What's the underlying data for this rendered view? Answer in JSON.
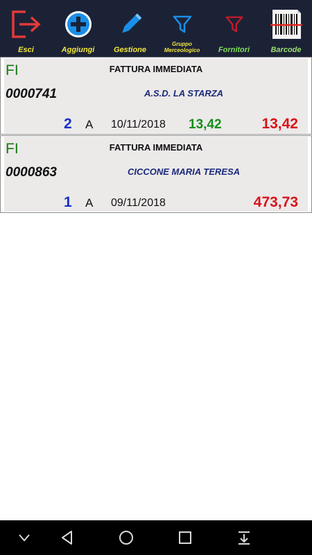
{
  "toolbar": {
    "buttons": [
      {
        "label": "Esci",
        "icon": "exit-icon"
      },
      {
        "label": "Aggiungi",
        "icon": "add-icon"
      },
      {
        "label": "Gestione",
        "icon": "pencil-icon"
      },
      {
        "label": "Gruppo Merceologico",
        "icon": "filter-icon"
      },
      {
        "label": "Fornitori",
        "icon": "filter-icon"
      },
      {
        "label": "Barcode",
        "icon": "barcode-icon"
      }
    ]
  },
  "documents": [
    {
      "type_code": "FI",
      "type_label": "FATTURA IMMEDIATA",
      "number": "0000741",
      "customer": "A.S.D. LA STARZA",
      "count": "2",
      "letter": "A",
      "date": "10/11/2018",
      "amount_partial": "13,42",
      "amount_total": "13,42"
    },
    {
      "type_code": "FI",
      "type_label": "FATTURA IMMEDIATA",
      "number": "0000863",
      "customer": "CICCONE MARIA TERESA",
      "count": "1",
      "letter": "A",
      "date": "09/11/2018",
      "amount_partial": "",
      "amount_total": "473,73"
    }
  ],
  "navbar": {
    "buttons": [
      "chevron-down-icon",
      "back-icon",
      "home-icon",
      "recents-icon",
      "notifications-pull-icon"
    ]
  },
  "colors": {
    "toolbar_bg": "#1c2236",
    "doc_type_green": "#127a12",
    "count_blue": "#1530c8",
    "partial_green": "#138f1a",
    "total_red": "#d8141a",
    "customer_navy": "#1a2a7a"
  }
}
